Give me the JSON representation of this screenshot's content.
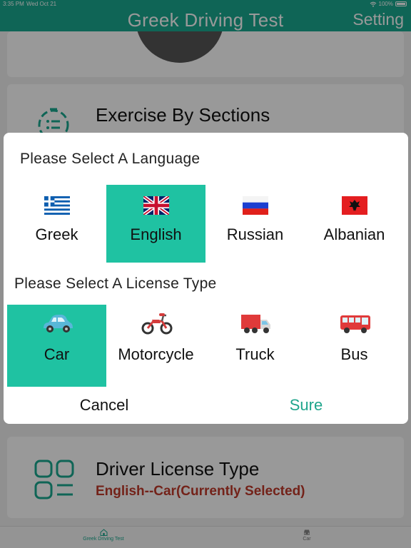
{
  "status_bar": {
    "time": "3:35 PM",
    "date": "Wed Oct 21",
    "battery": "100%"
  },
  "header": {
    "title": "Greek Driving Test",
    "setting_label": "Setting"
  },
  "cards": {
    "exercise_label": "Exercise By Sections",
    "license_label": "Driver License Type",
    "license_value": "English--Car(Currently Selected)"
  },
  "tabs": [
    {
      "label": "Greek Driving Test",
      "icon": "home-icon",
      "active": true
    },
    {
      "label": "Car",
      "icon": "car-icon",
      "active": false
    }
  ],
  "modal": {
    "language_title": "Please Select A Language",
    "languages": [
      {
        "label": "Greek",
        "flag": "greece-flag-icon",
        "selected": false
      },
      {
        "label": "English",
        "flag": "uk-flag-icon",
        "selected": true
      },
      {
        "label": "Russian",
        "flag": "russia-flag-icon",
        "selected": false
      },
      {
        "label": "Albanian",
        "flag": "albania-flag-icon",
        "selected": false
      }
    ],
    "license_title": "Please Select A License Type",
    "license_types": [
      {
        "label": "Car",
        "icon": "car-icon",
        "selected": true
      },
      {
        "label": "Motorcycle",
        "icon": "motorcycle-icon",
        "selected": false
      },
      {
        "label": "Truck",
        "icon": "truck-icon",
        "selected": false
      },
      {
        "label": "Bus",
        "icon": "bus-icon",
        "selected": false
      }
    ],
    "cancel_label": "Cancel",
    "sure_label": "Sure"
  },
  "colors": {
    "brand": "#1aa88f",
    "selected_bg": "#1fc2a2",
    "confirm_text": "#1fa58c",
    "current_selection_text": "#c0392b"
  }
}
